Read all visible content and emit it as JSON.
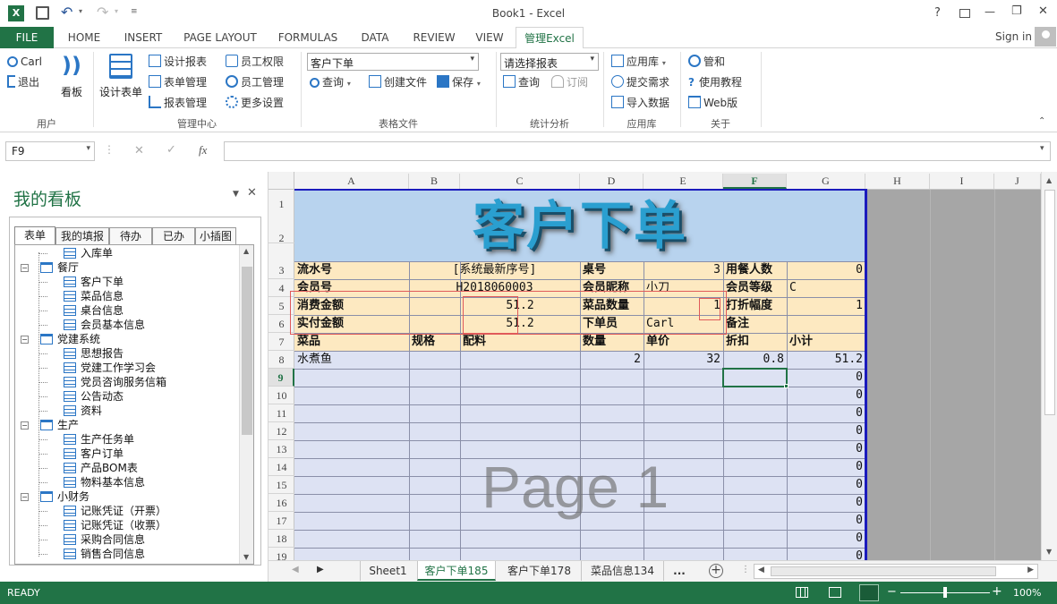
{
  "window": {
    "title": "Book1 - Excel",
    "help": "?",
    "minimize": "—",
    "restore": "❐",
    "close": "✕"
  },
  "tabs": {
    "file": "FILE",
    "items": [
      "HOME",
      "INSERT",
      "PAGE LAYOUT",
      "FORMULAS",
      "DATA",
      "REVIEW",
      "VIEW",
      "管理Excel"
    ],
    "signin": "Sign in"
  },
  "ribbon": {
    "user": {
      "name": "Carl",
      "logout": "退出",
      "board": "看板",
      "label": "用户"
    },
    "mgmt": {
      "design_form": "设计表单",
      "design_report": "设计报表",
      "form_mgmt": "表单管理",
      "report_mgmt": "报表管理",
      "emp_perm": "员工权限",
      "emp_mgmt": "员工管理",
      "more": "更多设置",
      "label": "管理中心"
    },
    "tables": {
      "selected": "客户下单",
      "query": "查询",
      "create": "创建文件",
      "save": "保存",
      "label": "表格文件"
    },
    "stats": {
      "placeholder": "请选择报表",
      "query": "查询",
      "subscribe": "订阅",
      "label": "统计分析"
    },
    "apps": {
      "library": "应用库",
      "submit": "提交需求",
      "import": "导入数据",
      "label": "应用库"
    },
    "about": {
      "admin": "管和",
      "tutorial": "使用教程",
      "web": "Web版",
      "label": "关于"
    }
  },
  "formula": {
    "namebox": "F9",
    "cancel": "✕",
    "enter": "✓",
    "fx": "fx",
    "value": ""
  },
  "pane": {
    "title": "我的看板",
    "tabs": [
      "表单",
      "我的填报",
      "待办",
      "已办",
      "小插图"
    ],
    "tree": [
      {
        "level": 1,
        "label": "入库单"
      },
      {
        "level": 0,
        "label": "餐厅"
      },
      {
        "level": 1,
        "label": "客户下单"
      },
      {
        "level": 1,
        "label": "菜品信息"
      },
      {
        "level": 1,
        "label": "桌台信息"
      },
      {
        "level": 1,
        "label": "会员基本信息"
      },
      {
        "level": 0,
        "label": "党建系统"
      },
      {
        "level": 1,
        "label": "思想报告"
      },
      {
        "level": 1,
        "label": "党建工作学习会"
      },
      {
        "level": 1,
        "label": "党员咨询服务信箱"
      },
      {
        "level": 1,
        "label": "公告动态"
      },
      {
        "level": 1,
        "label": "资料"
      },
      {
        "level": 0,
        "label": "生产"
      },
      {
        "level": 1,
        "label": "生产任务单"
      },
      {
        "level": 1,
        "label": "客户订单"
      },
      {
        "level": 1,
        "label": "产品BOM表"
      },
      {
        "level": 1,
        "label": "物料基本信息"
      },
      {
        "level": 0,
        "label": "小财务"
      },
      {
        "level": 1,
        "label": "记账凭证（开票）"
      },
      {
        "level": 1,
        "label": "记账凭证（收票）"
      },
      {
        "level": 1,
        "label": "采购合同信息"
      },
      {
        "level": 1,
        "label": "销售合同信息"
      }
    ]
  },
  "columns": [
    "A",
    "B",
    "C",
    "D",
    "E",
    "F",
    "G",
    "H",
    "I",
    "J"
  ],
  "rows": [
    "1",
    "2",
    "3",
    "4",
    "5",
    "6",
    "7",
    "8",
    "9",
    "10",
    "11",
    "12",
    "13",
    "14",
    "15",
    "16",
    "17",
    "18",
    "19"
  ],
  "sheet": {
    "banner": "客户下单",
    "watermark": "Page 1",
    "r3": {
      "a": "流水号",
      "bc": "[系统最新序号]",
      "d": "桌号",
      "e": "3",
      "f": "用餐人数",
      "g": "0"
    },
    "r4": {
      "a": "会员号",
      "bc": "H2018060003",
      "d": "会员昵称",
      "e": "小刀",
      "f": "会员等级",
      "g": "C"
    },
    "r5": {
      "a": "消费金额",
      "c": "51.2",
      "d": "菜品数量",
      "e": "1",
      "f": "打折幅度",
      "g": "1"
    },
    "r6": {
      "a": "实付金额",
      "c": "51.2",
      "d": "下单员",
      "e": "Carl",
      "f": "备注",
      "g": ""
    },
    "r7": {
      "a": "菜品",
      "b": "规格",
      "c": "配料",
      "d": "数量",
      "e": "单价",
      "f": "折扣",
      "g": "小计"
    },
    "r8": {
      "a": "水煮鱼",
      "d": "2",
      "e": "32",
      "f": "0.8",
      "g": "51.2"
    },
    "zeros": [
      "0",
      "0",
      "0",
      "0",
      "0",
      "0",
      "0",
      "0",
      "0",
      "0",
      "0"
    ]
  },
  "sheettabs": [
    "Sheet1",
    "客户下单185",
    "客户下单178",
    "菜品信息134",
    "..."
  ],
  "status": {
    "ready": "READY",
    "zoom": "100%"
  },
  "colors": {
    "excel_green": "#217346",
    "header_blue": "#b8d3ee",
    "label_yellow": "#fde9c1",
    "body_blue": "#dde2f3",
    "border_blue": "#1b1bbd"
  }
}
